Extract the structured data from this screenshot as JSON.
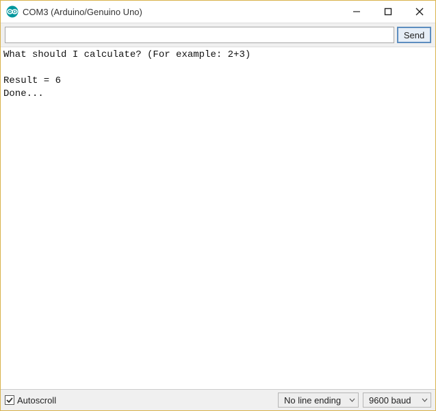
{
  "window": {
    "title": "COM3 (Arduino/Genuino Uno)"
  },
  "input": {
    "value": "",
    "send_label": "Send"
  },
  "console": {
    "text": "What should I calculate? (For example: 2+3)\n\nResult = 6\nDone..."
  },
  "footer": {
    "autoscroll_label": "Autoscroll",
    "autoscroll_checked": true,
    "line_ending_selected": "No line ending",
    "baud_selected": "9600 baud"
  }
}
